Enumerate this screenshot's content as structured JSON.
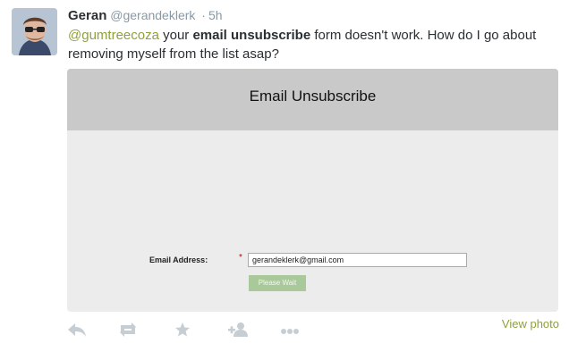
{
  "tweet": {
    "fullname": "Geran",
    "username": "@gerandeklerk",
    "separator": "·",
    "time": "5h",
    "text": {
      "mention": "@gumtreecoza",
      "part1": " your ",
      "bold": "email unsubscribe",
      "part2": " form doesn't work. How do I go about removing myself from the list asap?"
    }
  },
  "media": {
    "title": "Email Unsubscribe",
    "form": {
      "email_label": "Email Address:",
      "required_marker": "*",
      "email_value": "gerandeklerk@gmail.com",
      "button_label": "Please Wait"
    }
  },
  "actions": {
    "icons": [
      "reply-icon",
      "retweet-icon",
      "favorite-icon",
      "follow-icon",
      "more-icon"
    ],
    "view_photo_label": "View photo"
  },
  "colors": {
    "link": "#8ea23c",
    "icon": "#c6ced4",
    "media_bg": "#ececec",
    "media_header_bg": "#c9c9c9",
    "button_bg": "#a9c99b"
  }
}
